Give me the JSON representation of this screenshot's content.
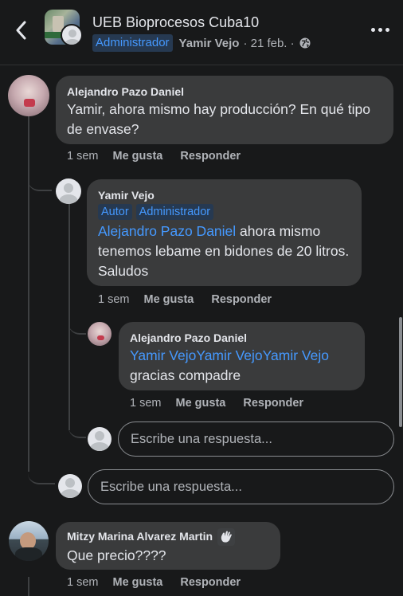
{
  "header": {
    "group_name": "UEB Bioprocesos Cuba10",
    "role_badge": "Administrador",
    "author": "Yamir Vejo",
    "date": "· 21 feb. ·",
    "back_icon": "chevron-left-icon",
    "more_icon": "more-horizontal-icon",
    "privacy_icon": "globe-icon"
  },
  "comments": [
    {
      "author": "Alejandro Pazo Daniel",
      "text": "Yamir, ahora mismo hay producción? En qué tipo de envase?",
      "time": "1 sem",
      "like": "Me gusta",
      "reply": "Responder"
    },
    {
      "author": "Yamir Vejo",
      "badges": [
        "Autor",
        "Administrador"
      ],
      "mention": "Alejandro Pazo Daniel",
      "text": " ahora mismo tenemos lebame en bidones de 20 litros. Saludos",
      "time": "1 sem",
      "like": "Me gusta",
      "reply": "Responder"
    },
    {
      "author": "Alejandro Pazo Daniel",
      "mention": "Yamir VejoYamir VejoYamir Vejo",
      "text": "gracias compadre",
      "time": "1 sem",
      "like": "Me gusta",
      "reply": "Responder"
    },
    {
      "author": "Mitzy Marina Alvarez Martin",
      "author_icon": "wave-emoji-icon",
      "text": "Que precio????",
      "time": "1 sem",
      "like": "Me gusta",
      "reply": "Responder"
    }
  ],
  "reply_inputs": {
    "nested_placeholder": "Escribe una respuesta...",
    "thread_placeholder": "Escribe una respuesta..."
  },
  "colors": {
    "background": "#18191a",
    "bubble": "#3a3b3c",
    "link": "#4599ff",
    "badge_bg": "#263951",
    "secondary_text": "#b0b3b8"
  }
}
